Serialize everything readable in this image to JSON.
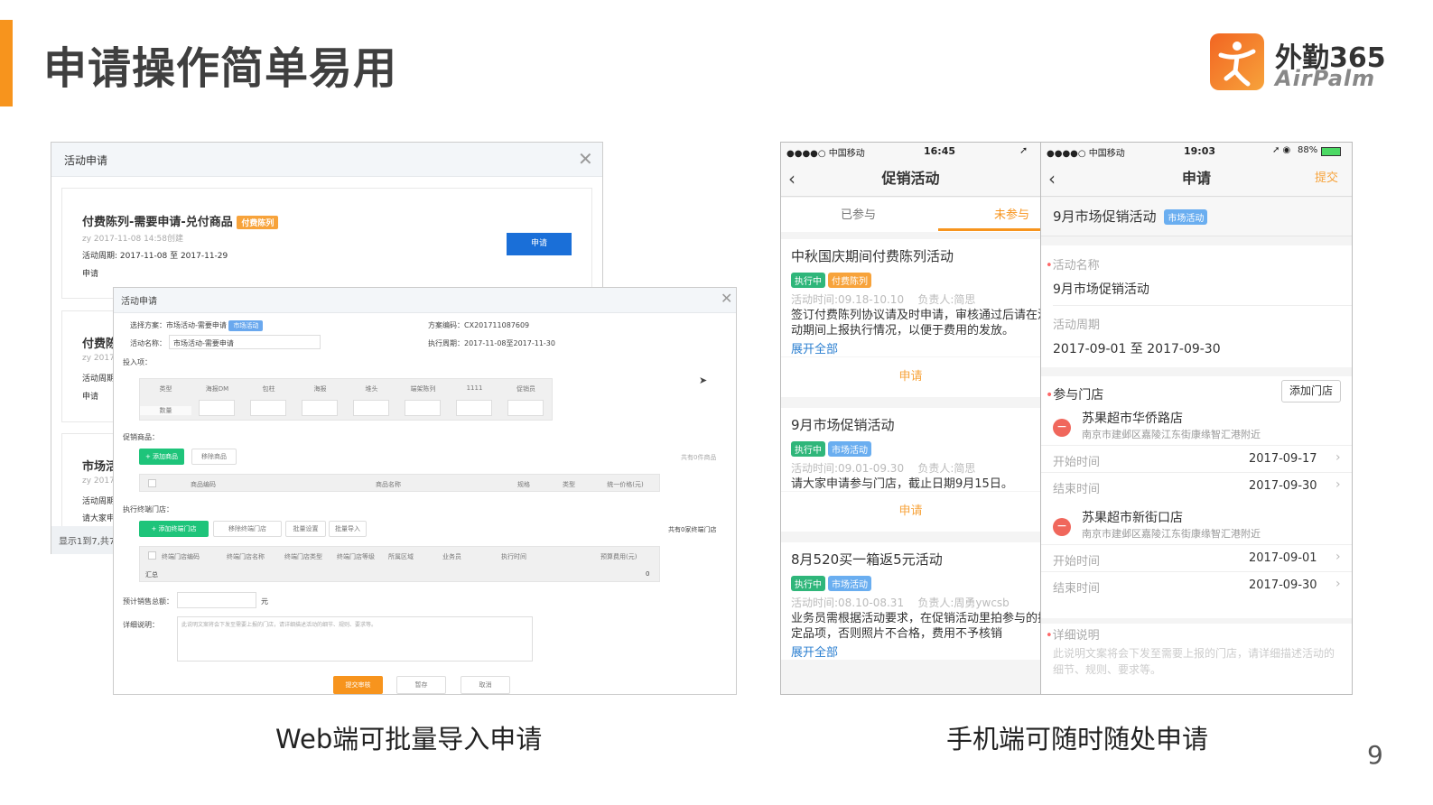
{
  "slide": {
    "title": "申请操作简单易用",
    "page_number": "9",
    "caption_web": "Web端可批量导入申请",
    "caption_mobile": "手机端可随时随处申请",
    "accent_color": "#f7941d"
  },
  "logo": {
    "cn": "外勤365",
    "en": "AirPalm"
  },
  "back_dialog": {
    "title": "活动申请",
    "card1": {
      "name": "付费陈列-需要申请-兑付商品",
      "tag": "付费陈列",
      "creator": "zy 2017-11-08 14:58创建",
      "period_label": "活动周期:",
      "period": "2017-11-08 至 2017-11-29",
      "status": "申请",
      "apply_button": "申请"
    },
    "card2": {
      "name": "付费陈",
      "creator": "zy 2017",
      "period_label": "活动周期",
      "status": "申请"
    },
    "card3": {
      "name": "市场活",
      "creator": "zy 2017",
      "period_label": "活动周期",
      "desc": "请大家申"
    },
    "footer": "显示1到7,共7记"
  },
  "front_dialog": {
    "title": "活动申请",
    "plan_label": "选择方案：",
    "plan_value": "市场活动-需要申请",
    "plan_tag": "市场活动",
    "code_label": "方案编码：",
    "code_value": "CX201711087609",
    "name_label": "活动名称：",
    "name_value": "市场活动-需要申请",
    "exec_label": "执行周期：",
    "exec_value": "2017-11-08至2017-11-30",
    "input_label": "投入项：",
    "input_columns": [
      "类型",
      "海报DM",
      "包柱",
      "海报",
      "堆头",
      "端架陈列",
      "1111",
      "促销员"
    ],
    "input_row_label": "数量",
    "goods_label": "促销商品：",
    "add_goods": "+ 添加商品",
    "remove_goods": "移除商品",
    "goods_count": "共有0件商品",
    "goods_columns": [
      "商品编码",
      "商品名称",
      "规格",
      "类型",
      "统一价格(元)"
    ],
    "stores_label": "执行终端门店：",
    "add_store": "+ 添加终端门店",
    "remove_store": "移除终端门店",
    "batch_set": "批量设置",
    "batch_import": "批量导入",
    "store_count": "共有0家终端门店",
    "store_columns": [
      "终端门店编码",
      "终端门店名称",
      "终端门店类型",
      "终端门店等级",
      "所属区域",
      "业务员",
      "执行时间",
      "预算费用(元)"
    ],
    "summary_label": "汇总",
    "summary_value": "0",
    "sales_label": "预计销售总额：",
    "sales_unit": "元",
    "detail_label": "详细说明：",
    "detail_placeholder": "此说明文案将会下发至需要上报的门店，请详细描述活动的细节、规则、要求等。",
    "submit": "提交审核",
    "save": "暂存",
    "cancel": "取消"
  },
  "phone1": {
    "carrier": "●●●●○ 中国移动",
    "time": "16:45",
    "title": "促销活动",
    "tabs": [
      {
        "label": "已参与",
        "active": false
      },
      {
        "label": "未参与",
        "active": true
      }
    ],
    "items": [
      {
        "title": "中秋国庆期间付费陈列活动",
        "tags": [
          "执行中",
          "付费陈列"
        ],
        "time": "活动时间:09.18-10.10",
        "owner": "负责人:简思",
        "desc": "签订付费陈列协议请及时申请，审核通过后请在活动期间上报执行情况，以便于费用的发放。",
        "expand": "展开全部",
        "apply": "申请"
      },
      {
        "title": "9月市场促销活动",
        "tags": [
          "执行中",
          "市场活动"
        ],
        "time": "活动时间:09.01-09.30",
        "owner": "负责人:简思",
        "desc": "请大家申请参与门店，截止日期9月15日。",
        "apply": "申请"
      },
      {
        "title": "8月520买一箱返5元活动",
        "tags": [
          "执行中",
          "市场活动"
        ],
        "time": "活动时间:08.10-08.31",
        "owner": "负责人:周勇ywcsb",
        "desc": "业务员需根据活动要求，在促销活动里拍参与的指定品项，否则照片不合格，费用不予核销",
        "expand": "展开全部"
      }
    ]
  },
  "phone2": {
    "carrier": "●●●●○ 中国移动",
    "time": "19:03",
    "battery": "88%",
    "title": "申请",
    "submit": "提交",
    "activity": "9月市场促销活动",
    "activity_tag": "市场活动",
    "name_label": "活动名称",
    "name_value": "9月市场促销活动",
    "period_label": "活动周期",
    "period_value": "2017-09-01 至 2017-09-30",
    "stores_label": "参与门店",
    "add_store": "添加门店",
    "stores": [
      {
        "name": "苏果超市华侨路店",
        "address": "南京市建邺区嘉陵江东街康缘智汇港附近",
        "start_label": "开始时间",
        "start": "2017-09-17",
        "end_label": "结束时间",
        "end": "2017-09-30"
      },
      {
        "name": "苏果超市新街口店",
        "address": "南京市建邺区嘉陵江东街康缘智汇港附近",
        "start_label": "开始时间",
        "start": "2017-09-01",
        "end_label": "结束时间",
        "end": "2017-09-30"
      }
    ],
    "detail_label": "详细说明",
    "detail_placeholder": "此说明文案将会下发至需要上报的门店，请详细描述活动的细节、规则、要求等。"
  }
}
